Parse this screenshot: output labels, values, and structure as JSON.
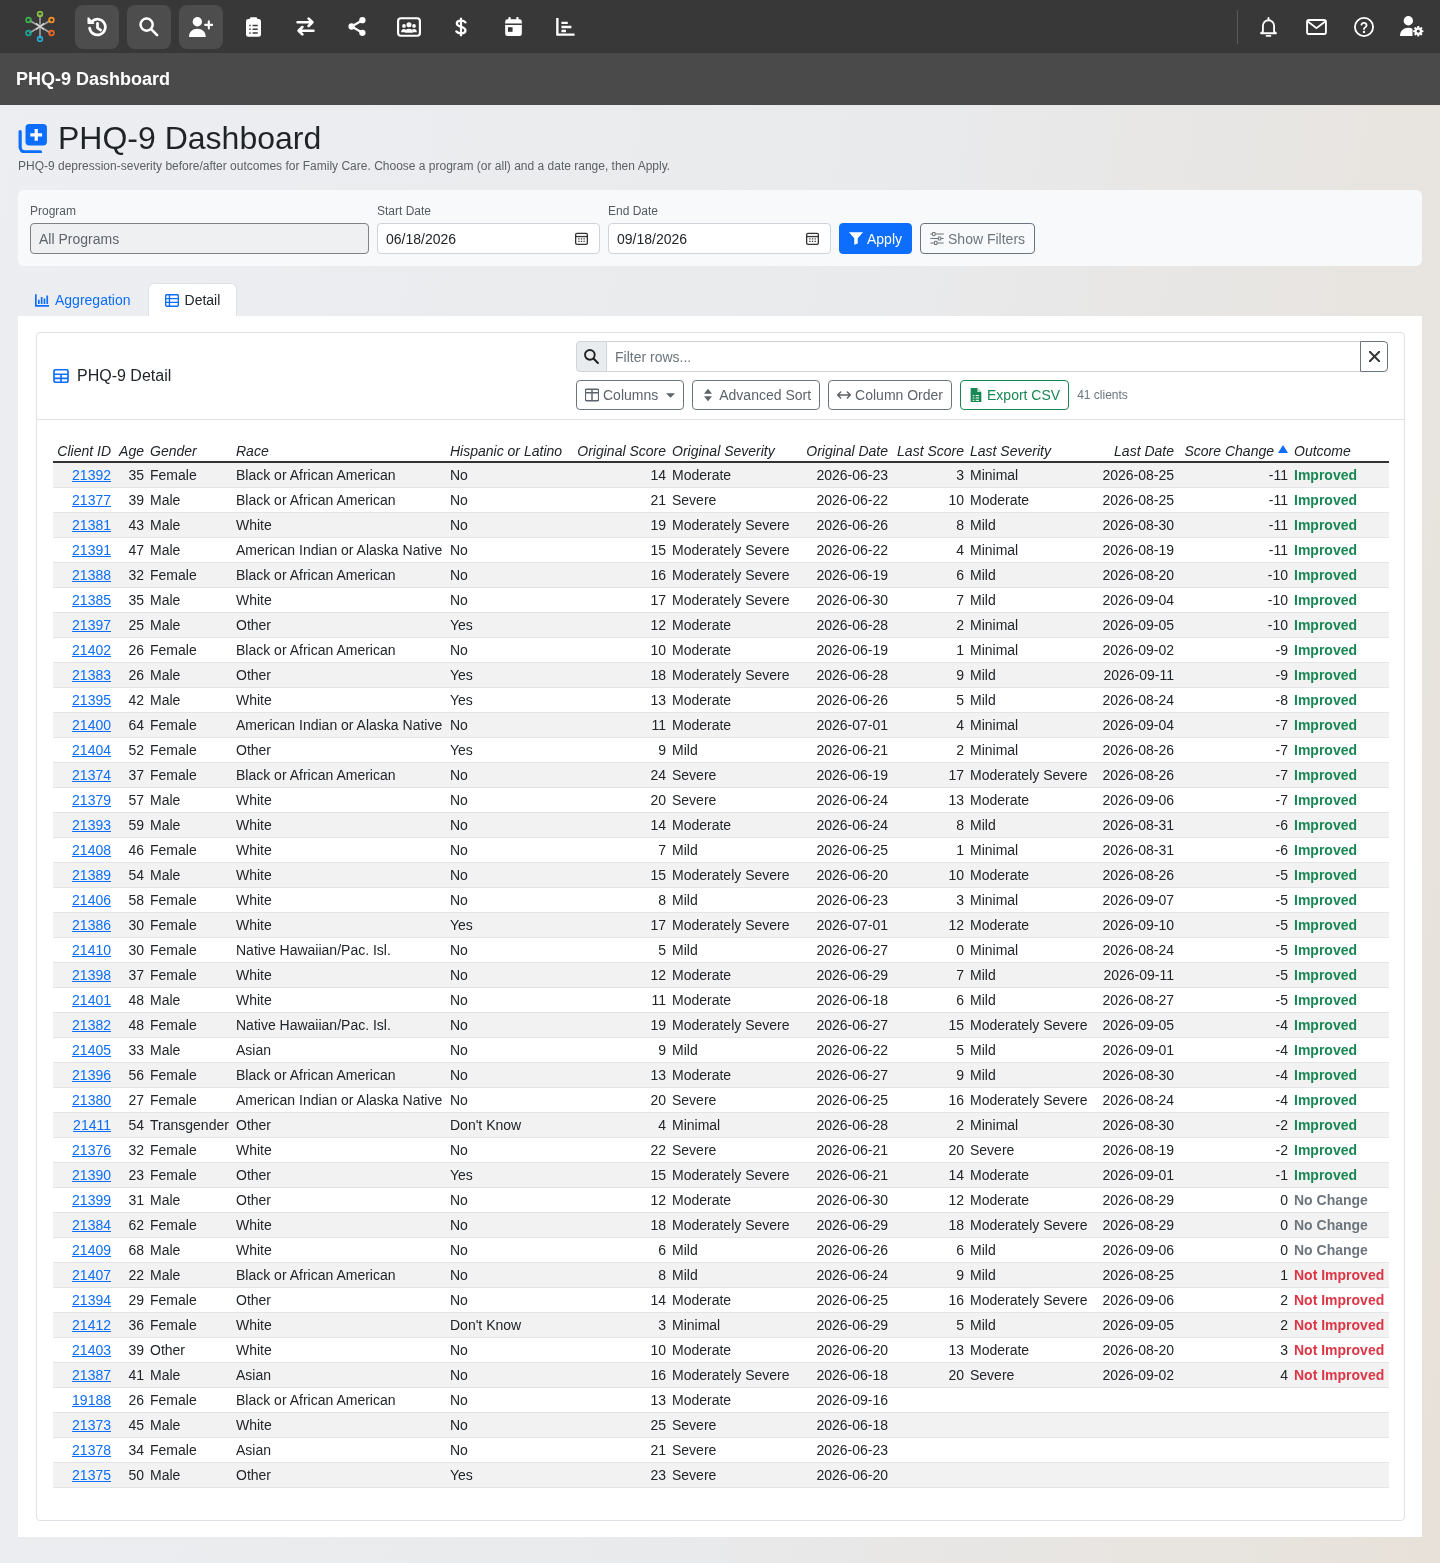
{
  "nav": {
    "buttons": [
      {
        "kind": "history",
        "highlighted": true
      },
      {
        "kind": "search",
        "highlighted": true
      },
      {
        "kind": "adduser",
        "highlighted": true
      },
      {
        "kind": "clipboard",
        "highlighted": false
      },
      {
        "kind": "transfer",
        "highlighted": false
      },
      {
        "kind": "share",
        "highlighted": false
      },
      {
        "kind": "idcard",
        "highlighted": false
      },
      {
        "kind": "dollar",
        "highlighted": false
      },
      {
        "kind": "calendar",
        "highlighted": false
      },
      {
        "kind": "chart",
        "highlighted": false
      }
    ],
    "right_buttons": [
      {
        "kind": "bell"
      },
      {
        "kind": "mail"
      },
      {
        "kind": "help"
      },
      {
        "kind": "usergear"
      }
    ]
  },
  "app_bar": {
    "title": "PHQ-9 Dashboard"
  },
  "page": {
    "title": "PHQ-9 Dashboard",
    "subtitle": "PHQ-9 depression-severity before/after outcomes for Family Care. Choose a program (or all) and a date range, then Apply."
  },
  "filters": {
    "program": {
      "label": "Program",
      "value": "All Programs"
    },
    "start_date": {
      "label": "Start Date",
      "value": "06/18/2026"
    },
    "end_date": {
      "label": "End Date",
      "value": "09/18/2026"
    },
    "buttons": [
      {
        "label": "Apply",
        "kind": "primary"
      },
      {
        "label": "Show Filters",
        "kind": "secondary"
      }
    ]
  },
  "tabs": [
    {
      "label": "Aggregation",
      "kind": "chart",
      "selected": false
    },
    {
      "label": "Detail",
      "kind": "table",
      "selected": true
    }
  ],
  "detail": {
    "title": "PHQ-9 Detail",
    "filter": {
      "placeholder": "Filter rows..."
    },
    "toolbar": [
      {
        "label": "Columns",
        "kind": "columns"
      },
      {
        "label": "Advanced Sort",
        "kind": "sort"
      },
      {
        "label": "Column Order",
        "kind": "order"
      },
      {
        "label": "Export CSV",
        "kind": "export"
      }
    ],
    "count": "41 clients",
    "table": {
      "columns": [
        {
          "label": "Client ID",
          "sorted": false
        },
        {
          "label": "Age",
          "sorted": false
        },
        {
          "label": "Gender",
          "sorted": false
        },
        {
          "label": "Race",
          "sorted": false
        },
        {
          "label": "Hispanic or Latino",
          "sorted": false
        },
        {
          "label": "Original Score",
          "sorted": false
        },
        {
          "label": "Original Severity",
          "sorted": false
        },
        {
          "label": "Original Date",
          "sorted": false
        },
        {
          "label": "Last Score",
          "sorted": false
        },
        {
          "label": "Last Severity",
          "sorted": false
        },
        {
          "label": "Last Date",
          "sorted": false
        },
        {
          "label": "Score Change",
          "sorted": true
        },
        {
          "label": "Outcome",
          "sorted": false
        }
      ],
      "rows": [
        {
          "cells": [
            "21392",
            "35",
            "Female",
            "Black or African American",
            "No",
            "14",
            "Moderate",
            "2026-06-23",
            "3",
            "Minimal",
            "2026-08-25",
            "-11"
          ],
          "outcome": {
            "label": "Improved",
            "kind": "improved"
          }
        },
        {
          "cells": [
            "21377",
            "39",
            "Male",
            "Black or African American",
            "No",
            "21",
            "Severe",
            "2026-06-22",
            "10",
            "Moderate",
            "2026-08-25",
            "-11"
          ],
          "outcome": {
            "label": "Improved",
            "kind": "improved"
          }
        },
        {
          "cells": [
            "21381",
            "43",
            "Male",
            "White",
            "No",
            "19",
            "Moderately Severe",
            "2026-06-26",
            "8",
            "Mild",
            "2026-08-30",
            "-11"
          ],
          "outcome": {
            "label": "Improved",
            "kind": "improved"
          }
        },
        {
          "cells": [
            "21391",
            "47",
            "Male",
            "American Indian or Alaska Native",
            "No",
            "15",
            "Moderately Severe",
            "2026-06-22",
            "4",
            "Minimal",
            "2026-08-19",
            "-11"
          ],
          "outcome": {
            "label": "Improved",
            "kind": "improved"
          }
        },
        {
          "cells": [
            "21388",
            "32",
            "Female",
            "Black or African American",
            "No",
            "16",
            "Moderately Severe",
            "2026-06-19",
            "6",
            "Mild",
            "2026-08-20",
            "-10"
          ],
          "outcome": {
            "label": "Improved",
            "kind": "improved"
          }
        },
        {
          "cells": [
            "21385",
            "35",
            "Male",
            "White",
            "No",
            "17",
            "Moderately Severe",
            "2026-06-30",
            "7",
            "Mild",
            "2026-09-04",
            "-10"
          ],
          "outcome": {
            "label": "Improved",
            "kind": "improved"
          }
        },
        {
          "cells": [
            "21397",
            "25",
            "Male",
            "Other",
            "Yes",
            "12",
            "Moderate",
            "2026-06-28",
            "2",
            "Minimal",
            "2026-09-05",
            "-10"
          ],
          "outcome": {
            "label": "Improved",
            "kind": "improved"
          }
        },
        {
          "cells": [
            "21402",
            "26",
            "Female",
            "Black or African American",
            "No",
            "10",
            "Moderate",
            "2026-06-19",
            "1",
            "Minimal",
            "2026-09-02",
            "-9"
          ],
          "outcome": {
            "label": "Improved",
            "kind": "improved"
          }
        },
        {
          "cells": [
            "21383",
            "26",
            "Male",
            "Other",
            "Yes",
            "18",
            "Moderately Severe",
            "2026-06-28",
            "9",
            "Mild",
            "2026-09-11",
            "-9"
          ],
          "outcome": {
            "label": "Improved",
            "kind": "improved"
          }
        },
        {
          "cells": [
            "21395",
            "42",
            "Male",
            "White",
            "Yes",
            "13",
            "Moderate",
            "2026-06-26",
            "5",
            "Mild",
            "2026-08-24",
            "-8"
          ],
          "outcome": {
            "label": "Improved",
            "kind": "improved"
          }
        },
        {
          "cells": [
            "21400",
            "64",
            "Female",
            "American Indian or Alaska Native",
            "No",
            "11",
            "Moderate",
            "2026-07-01",
            "4",
            "Minimal",
            "2026-09-04",
            "-7"
          ],
          "outcome": {
            "label": "Improved",
            "kind": "improved"
          }
        },
        {
          "cells": [
            "21404",
            "52",
            "Female",
            "Other",
            "Yes",
            "9",
            "Mild",
            "2026-06-21",
            "2",
            "Minimal",
            "2026-08-26",
            "-7"
          ],
          "outcome": {
            "label": "Improved",
            "kind": "improved"
          }
        },
        {
          "cells": [
            "21374",
            "37",
            "Female",
            "Black or African American",
            "No",
            "24",
            "Severe",
            "2026-06-19",
            "17",
            "Moderately Severe",
            "2026-08-26",
            "-7"
          ],
          "outcome": {
            "label": "Improved",
            "kind": "improved"
          }
        },
        {
          "cells": [
            "21379",
            "57",
            "Male",
            "White",
            "No",
            "20",
            "Severe",
            "2026-06-24",
            "13",
            "Moderate",
            "2026-09-06",
            "-7"
          ],
          "outcome": {
            "label": "Improved",
            "kind": "improved"
          }
        },
        {
          "cells": [
            "21393",
            "59",
            "Male",
            "White",
            "No",
            "14",
            "Moderate",
            "2026-06-24",
            "8",
            "Mild",
            "2026-08-31",
            "-6"
          ],
          "outcome": {
            "label": "Improved",
            "kind": "improved"
          }
        },
        {
          "cells": [
            "21408",
            "46",
            "Female",
            "White",
            "No",
            "7",
            "Mild",
            "2026-06-25",
            "1",
            "Minimal",
            "2026-08-31",
            "-6"
          ],
          "outcome": {
            "label": "Improved",
            "kind": "improved"
          }
        },
        {
          "cells": [
            "21389",
            "54",
            "Male",
            "White",
            "No",
            "15",
            "Moderately Severe",
            "2026-06-20",
            "10",
            "Moderate",
            "2026-08-26",
            "-5"
          ],
          "outcome": {
            "label": "Improved",
            "kind": "improved"
          }
        },
        {
          "cells": [
            "21406",
            "58",
            "Female",
            "White",
            "No",
            "8",
            "Mild",
            "2026-06-23",
            "3",
            "Minimal",
            "2026-09-07",
            "-5"
          ],
          "outcome": {
            "label": "Improved",
            "kind": "improved"
          }
        },
        {
          "cells": [
            "21386",
            "30",
            "Female",
            "White",
            "Yes",
            "17",
            "Moderately Severe",
            "2026-07-01",
            "12",
            "Moderate",
            "2026-09-10",
            "-5"
          ],
          "outcome": {
            "label": "Improved",
            "kind": "improved"
          }
        },
        {
          "cells": [
            "21410",
            "30",
            "Female",
            "Native Hawaiian/Pac. Isl.",
            "No",
            "5",
            "Mild",
            "2026-06-27",
            "0",
            "Minimal",
            "2026-08-24",
            "-5"
          ],
          "outcome": {
            "label": "Improved",
            "kind": "improved"
          }
        },
        {
          "cells": [
            "21398",
            "37",
            "Female",
            "White",
            "No",
            "12",
            "Moderate",
            "2026-06-29",
            "7",
            "Mild",
            "2026-09-11",
            "-5"
          ],
          "outcome": {
            "label": "Improved",
            "kind": "improved"
          }
        },
        {
          "cells": [
            "21401",
            "48",
            "Male",
            "White",
            "No",
            "11",
            "Moderate",
            "2026-06-18",
            "6",
            "Mild",
            "2026-08-27",
            "-5"
          ],
          "outcome": {
            "label": "Improved",
            "kind": "improved"
          }
        },
        {
          "cells": [
            "21382",
            "48",
            "Female",
            "Native Hawaiian/Pac. Isl.",
            "No",
            "19",
            "Moderately Severe",
            "2026-06-27",
            "15",
            "Moderately Severe",
            "2026-09-05",
            "-4"
          ],
          "outcome": {
            "label": "Improved",
            "kind": "improved"
          }
        },
        {
          "cells": [
            "21405",
            "33",
            "Male",
            "Asian",
            "No",
            "9",
            "Mild",
            "2026-06-22",
            "5",
            "Mild",
            "2026-09-01",
            "-4"
          ],
          "outcome": {
            "label": "Improved",
            "kind": "improved"
          }
        },
        {
          "cells": [
            "21396",
            "56",
            "Female",
            "Black or African American",
            "No",
            "13",
            "Moderate",
            "2026-06-27",
            "9",
            "Mild",
            "2026-08-30",
            "-4"
          ],
          "outcome": {
            "label": "Improved",
            "kind": "improved"
          }
        },
        {
          "cells": [
            "21380",
            "27",
            "Female",
            "American Indian or Alaska Native",
            "No",
            "20",
            "Severe",
            "2026-06-25",
            "16",
            "Moderately Severe",
            "2026-08-24",
            "-4"
          ],
          "outcome": {
            "label": "Improved",
            "kind": "improved"
          }
        },
        {
          "cells": [
            "21411",
            "54",
            "Transgender",
            "Other",
            "Don't Know",
            "4",
            "Minimal",
            "2026-06-28",
            "2",
            "Minimal",
            "2026-08-30",
            "-2"
          ],
          "outcome": {
            "label": "Improved",
            "kind": "improved"
          }
        },
        {
          "cells": [
            "21376",
            "32",
            "Female",
            "White",
            "No",
            "22",
            "Severe",
            "2026-06-21",
            "20",
            "Severe",
            "2026-08-19",
            "-2"
          ],
          "outcome": {
            "label": "Improved",
            "kind": "improved"
          }
        },
        {
          "cells": [
            "21390",
            "23",
            "Female",
            "Other",
            "Yes",
            "15",
            "Moderately Severe",
            "2026-06-21",
            "14",
            "Moderate",
            "2026-09-01",
            "-1"
          ],
          "outcome": {
            "label": "Improved",
            "kind": "improved"
          }
        },
        {
          "cells": [
            "21399",
            "31",
            "Male",
            "Other",
            "No",
            "12",
            "Moderate",
            "2026-06-30",
            "12",
            "Moderate",
            "2026-08-29",
            "0"
          ],
          "outcome": {
            "label": "No Change",
            "kind": "unchanged"
          }
        },
        {
          "cells": [
            "21384",
            "62",
            "Female",
            "White",
            "No",
            "18",
            "Moderately Severe",
            "2026-06-29",
            "18",
            "Moderately Severe",
            "2026-08-29",
            "0"
          ],
          "outcome": {
            "label": "No Change",
            "kind": "unchanged"
          }
        },
        {
          "cells": [
            "21409",
            "68",
            "Male",
            "White",
            "No",
            "6",
            "Mild",
            "2026-06-26",
            "6",
            "Mild",
            "2026-09-06",
            "0"
          ],
          "outcome": {
            "label": "No Change",
            "kind": "unchanged"
          }
        },
        {
          "cells": [
            "21407",
            "22",
            "Male",
            "Black or African American",
            "No",
            "8",
            "Mild",
            "2026-06-24",
            "9",
            "Mild",
            "2026-08-25",
            "1"
          ],
          "outcome": {
            "label": "Not Improved",
            "kind": "worse"
          }
        },
        {
          "cells": [
            "21394",
            "29",
            "Female",
            "Other",
            "No",
            "14",
            "Moderate",
            "2026-06-25",
            "16",
            "Moderately Severe",
            "2026-09-06",
            "2"
          ],
          "outcome": {
            "label": "Not Improved",
            "kind": "worse"
          }
        },
        {
          "cells": [
            "21412",
            "36",
            "Female",
            "White",
            "Don't Know",
            "3",
            "Minimal",
            "2026-06-29",
            "5",
            "Mild",
            "2026-09-05",
            "2"
          ],
          "outcome": {
            "label": "Not Improved",
            "kind": "worse"
          }
        },
        {
          "cells": [
            "21403",
            "39",
            "Other",
            "White",
            "No",
            "10",
            "Moderate",
            "2026-06-20",
            "13",
            "Moderate",
            "2026-08-20",
            "3"
          ],
          "outcome": {
            "label": "Not Improved",
            "kind": "worse"
          }
        },
        {
          "cells": [
            "21387",
            "41",
            "Male",
            "Asian",
            "No",
            "16",
            "Moderately Severe",
            "2026-06-18",
            "20",
            "Severe",
            "2026-09-02",
            "4"
          ],
          "outcome": {
            "label": "Not Improved",
            "kind": "worse"
          }
        },
        {
          "cells": [
            "19188",
            "26",
            "Female",
            "Black or African American",
            "No",
            "13",
            "Moderate",
            "2026-09-16"
          ]
        },
        {
          "cells": [
            "21373",
            "45",
            "Male",
            "White",
            "No",
            "25",
            "Severe",
            "2026-06-18"
          ]
        },
        {
          "cells": [
            "21378",
            "34",
            "Female",
            "Asian",
            "No",
            "21",
            "Severe",
            "2026-06-23"
          ]
        },
        {
          "cells": [
            "21375",
            "50",
            "Male",
            "Other",
            "Yes",
            "23",
            "Severe",
            "2026-06-20"
          ]
        }
      ]
    }
  }
}
